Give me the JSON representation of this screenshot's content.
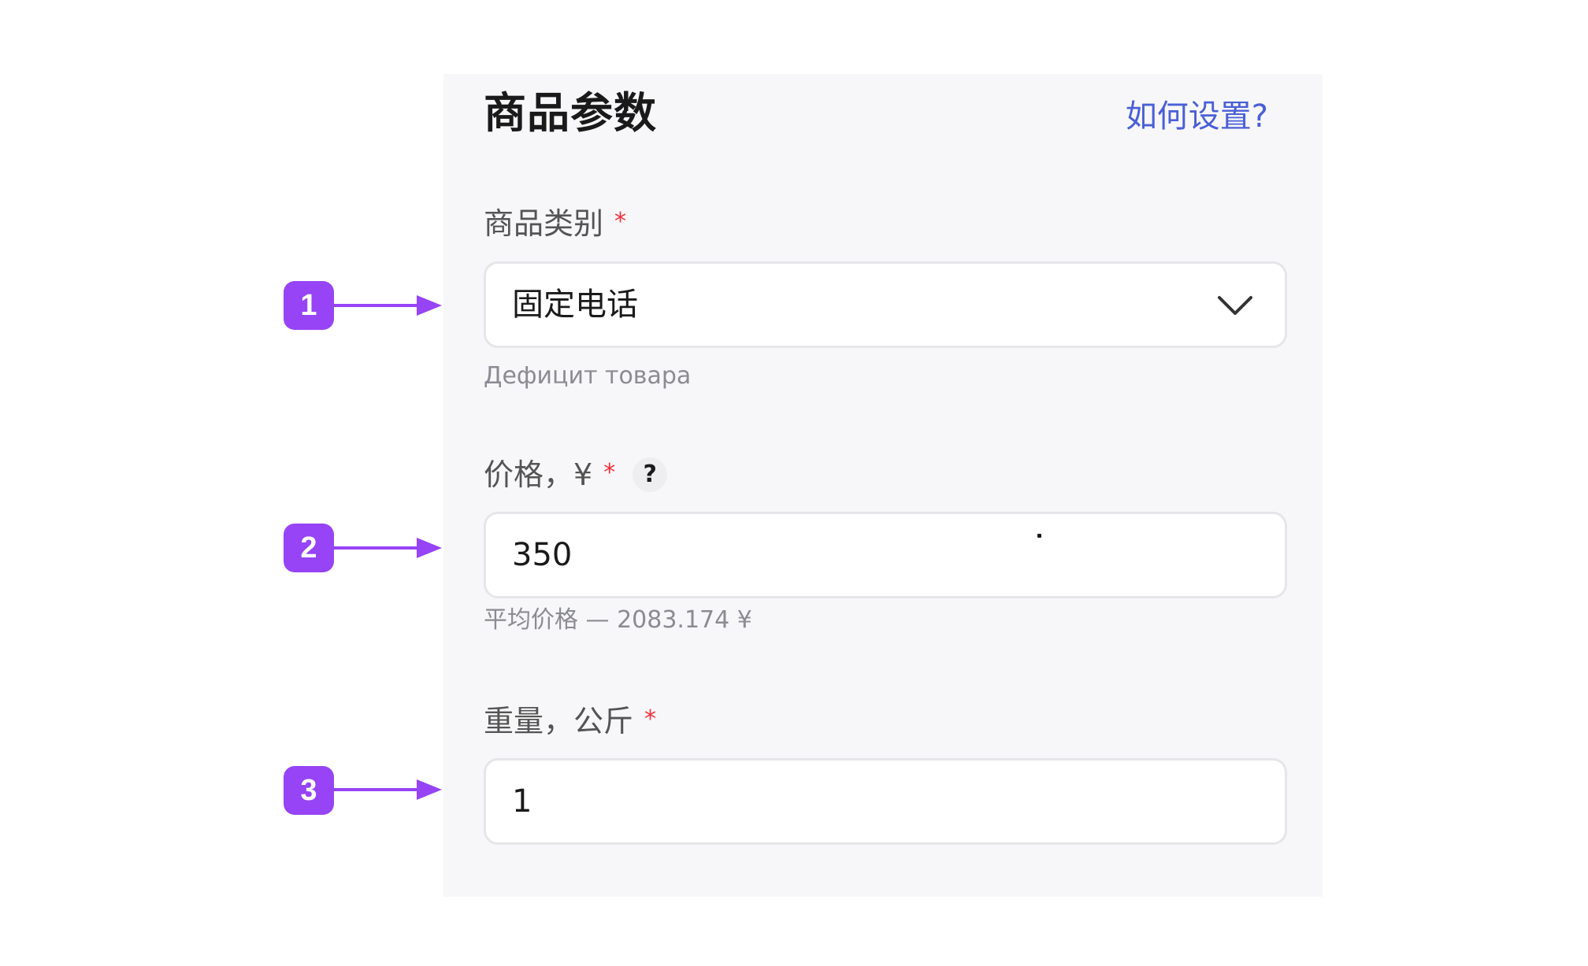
{
  "panel": {
    "title": "商品参数",
    "help_link": "如何设置?"
  },
  "fields": {
    "category": {
      "label": "商品类别",
      "required_mark": "*",
      "value": "固定电话",
      "hint": "Дефицит товара",
      "icon": "chevron-down-icon"
    },
    "price": {
      "label": "价格，¥",
      "required_mark": "*",
      "help_icon": "?",
      "value": "350",
      "hint": "平均价格 — 2083.174 ¥"
    },
    "weight": {
      "label": "重量，公斤",
      "required_mark": "*",
      "value": "1"
    }
  },
  "markers": [
    "1",
    "2",
    "3"
  ],
  "colors": {
    "panel_bg": "#f7f7f9",
    "link": "#4a5fd6",
    "required": "#f1303a",
    "marker": "#9644f5",
    "input_border": "#e6e6ea"
  }
}
